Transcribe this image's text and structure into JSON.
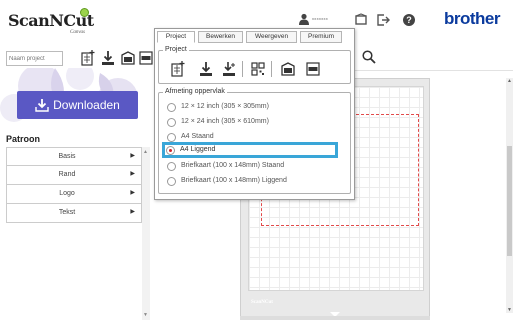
{
  "app": {
    "logo_text": "ScanNCut",
    "logo_sub": "Canvas",
    "brand": "brother",
    "user_name": "xxxxxxx"
  },
  "toolbar": {
    "project_placeholder": "Naam project",
    "download_label": "Downloaden"
  },
  "sidebar": {
    "title": "Patroon",
    "items": [
      {
        "label": "Basis"
      },
      {
        "label": "Rand"
      },
      {
        "label": "Logo"
      },
      {
        "label": "Tekst"
      }
    ]
  },
  "menu": {
    "tabs": [
      {
        "label": "Project"
      },
      {
        "label": "Bewerken"
      },
      {
        "label": "Weergeven"
      },
      {
        "label": "Premium"
      }
    ],
    "active_tab": "Project",
    "project_group_title": "Project",
    "area_group_title": "Afmeting oppervlak",
    "area_options": [
      {
        "label": "12 × 12 inch (305 × 305mm)"
      },
      {
        "label": "12 × 24 inch (305 × 610mm)"
      },
      {
        "label": "A4 Staand"
      },
      {
        "label": "A4 Liggend"
      },
      {
        "label": "Briefkaart (100 x 148mm) Staand"
      },
      {
        "label": "Briefkaart (100 x 148mm) Liggend"
      }
    ],
    "selected_option": "A4 Liggend"
  },
  "canvas": {
    "mat_brand": "ScanNCut"
  },
  "colors": {
    "download_button": "#5a58c4",
    "brand": "#0b3b9e",
    "selection_outline": "#3aa6d8",
    "radio_selected": "#d2232a",
    "cut_line": "#e24a4a"
  }
}
